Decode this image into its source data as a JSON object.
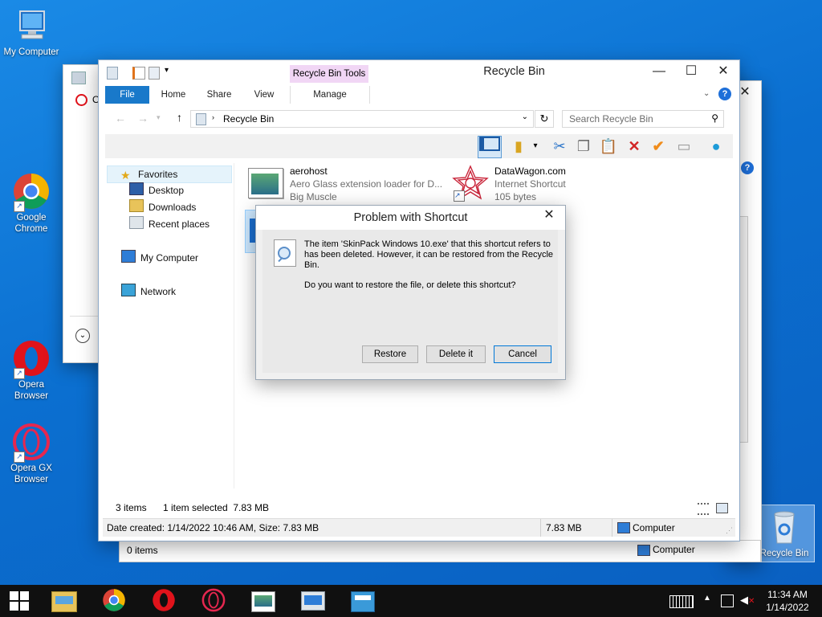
{
  "desktop": {
    "icons": [
      {
        "label": "My Computer"
      },
      {
        "label": "Google Chrome"
      },
      {
        "label": "Opera Browser"
      },
      {
        "label": "Opera GX Browser"
      },
      {
        "label": "Recycle Bin"
      }
    ]
  },
  "back_window": {
    "opera_initial": "O",
    "status_items": "0 items",
    "status_computer": "Computer"
  },
  "explorer": {
    "title": "Recycle Bin",
    "contextual_tab_group": "Recycle Bin Tools",
    "tabs": {
      "file": "File",
      "home": "Home",
      "share": "Share",
      "view": "View",
      "manage": "Manage"
    },
    "address": "Recycle Bin",
    "search_placeholder": "Search Recycle Bin",
    "nav": {
      "favorites": "Favorites",
      "desktop": "Desktop",
      "downloads": "Downloads",
      "recent": "Recent places",
      "my_computer": "My Computer",
      "network": "Network"
    },
    "files": [
      {
        "name": "aerohost",
        "desc": "Aero Glass extension loader for D...",
        "sub": "Big Muscle"
      },
      {
        "name": "DataWagon.com",
        "desc": "Internet Shortcut",
        "sub": "105 bytes"
      }
    ],
    "status": {
      "items": "3 items",
      "selected": "1 item selected  7.83 MB"
    },
    "details": {
      "info": "Date created: 1/14/2022 10:46 AM, Size: 7.83 MB",
      "size": "7.83 MB",
      "location": "Computer"
    }
  },
  "dialog": {
    "title": "Problem with Shortcut",
    "message": "The item 'SkinPack Windows 10.exe' that this shortcut refers to has been deleted. However, it can be restored from the Recycle Bin.",
    "question": "Do you want to restore the file, or delete this shortcut?",
    "buttons": {
      "restore": "Restore",
      "delete": "Delete it",
      "cancel": "Cancel"
    }
  },
  "taskbar": {
    "time": "11:34 AM",
    "date": "1/14/2022"
  },
  "colors": {
    "accent": "#0078d7",
    "desktop": "#0b6fd0",
    "taskbar": "#101010",
    "ribbon_group": "#f1d6f5"
  }
}
